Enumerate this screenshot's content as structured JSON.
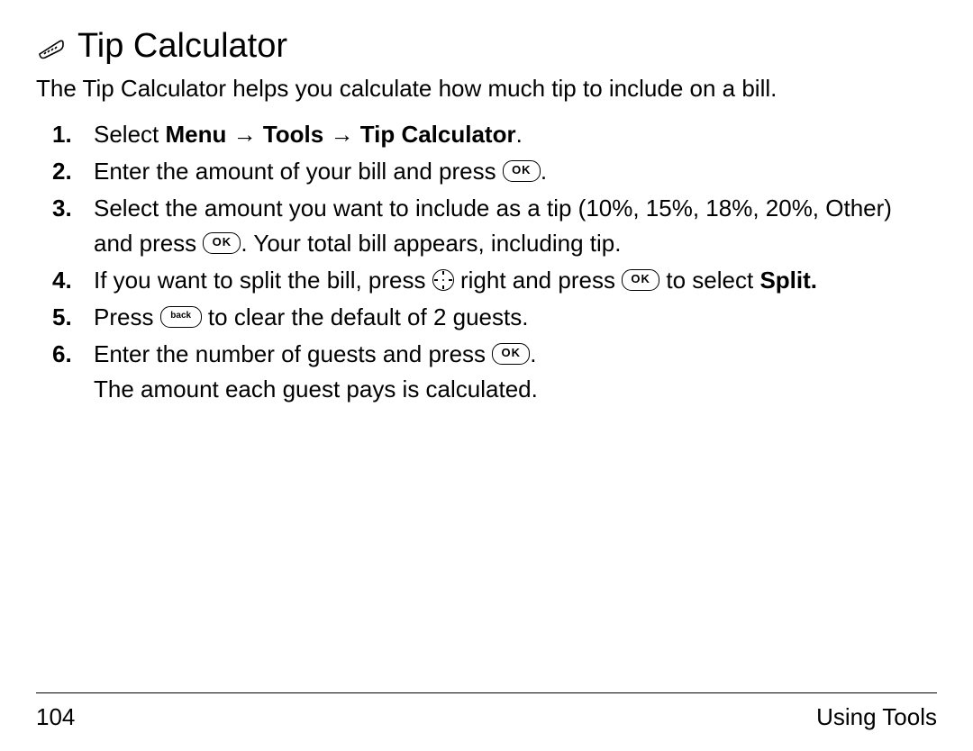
{
  "heading": "Tip Calculator",
  "intro": "The Tip Calculator helps you calculate how much tip to include on a bill.",
  "steps": {
    "s1": {
      "prefix": "Select ",
      "menu": "Menu",
      "arrow": " → ",
      "tools": "Tools",
      "calc": "Tip Calculator",
      "suffix": "."
    },
    "s2": {
      "a": "Enter the amount of your bill and press ",
      "b": "."
    },
    "s3": {
      "a": "Select the amount you want to include as a tip (10%, 15%, 18%, 20%, Other) and press ",
      "b": ". Your total bill appears, including tip."
    },
    "s4": {
      "a": "If you want to split the bill, press ",
      "b": " right and press ",
      "c": " to select ",
      "split": "Split."
    },
    "s5": {
      "a": "Press ",
      "b": " to clear the default of 2 guests."
    },
    "s6": {
      "a": "Enter the number of guests and press ",
      "b": ".",
      "c": "The amount each guest pays is calculated."
    }
  },
  "btn": {
    "ok": "OK",
    "back": "back"
  },
  "footer": {
    "page": "104",
    "section": "Using Tools"
  }
}
